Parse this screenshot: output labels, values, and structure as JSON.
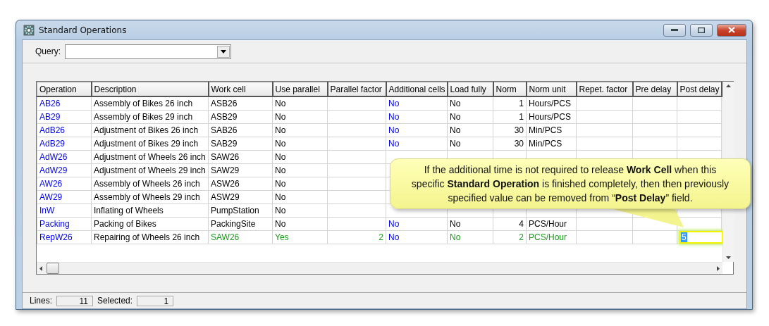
{
  "window": {
    "title": "Standard Operations"
  },
  "query": {
    "label": "Query:"
  },
  "table": {
    "columns": [
      "Operation",
      "Description",
      "Work cell",
      "Use parallel",
      "Parallel factor",
      "Additional cells",
      "Load fully",
      "Norm",
      "Norm unit",
      "Repet. factor",
      "Pre delay",
      "Post delay"
    ],
    "rows": [
      {
        "selected": false,
        "operation": "AB26",
        "description": "Assembly of Bikes 26 inch",
        "work_cell": "ASB26",
        "use_parallel": "No",
        "additional_cells": "No",
        "load_fully": "No",
        "norm": "1",
        "norm_unit": "Hours/PCS"
      },
      {
        "selected": false,
        "operation": "AB29",
        "description": "Assembly of Bikes 29 inch",
        "work_cell": "ASB29",
        "use_parallel": "No",
        "additional_cells": "No",
        "load_fully": "No",
        "norm": "1",
        "norm_unit": "Hours/PCS"
      },
      {
        "selected": false,
        "operation": "AdB26",
        "description": "Adjustment of Bikes 26 inch",
        "work_cell": "SAB26",
        "use_parallel": "No",
        "additional_cells": "No",
        "load_fully": "No",
        "norm": "30",
        "norm_unit": "Min/PCS"
      },
      {
        "selected": false,
        "operation": "AdB29",
        "description": "Adjustment of Bikes 29 inch",
        "work_cell": "SAB29",
        "use_parallel": "No",
        "additional_cells": "No",
        "load_fully": "No",
        "norm": "30",
        "norm_unit": "Min/PCS"
      },
      {
        "selected": false,
        "operation": "AdW26",
        "description": "Adjustment of Wheels 26 inch",
        "work_cell": "SAW26",
        "use_parallel": "No"
      },
      {
        "selected": false,
        "operation": "AdW29",
        "description": "Adjustment of Wheels 29 inch",
        "work_cell": "SAW29",
        "use_parallel": "No"
      },
      {
        "selected": false,
        "operation": "AW26",
        "description": "Assembly of Wheels 26 inch",
        "work_cell": "ASW26",
        "use_parallel": "No"
      },
      {
        "selected": false,
        "operation": "AW29",
        "description": "Assembly of Wheels 29 inch",
        "work_cell": "ASW29",
        "use_parallel": "No"
      },
      {
        "selected": false,
        "operation": "InW",
        "description": "Inflating of Wheels",
        "work_cell": "PumpStation",
        "use_parallel": "No"
      },
      {
        "selected": false,
        "operation": "Packing",
        "description": "Packing of Bikes",
        "work_cell": "PackingSite",
        "use_parallel": "No",
        "additional_cells": "No",
        "load_fully": "No",
        "norm": "4",
        "norm_unit": "PCS/Hour"
      },
      {
        "selected": true,
        "operation": "RepW26",
        "description": "Repairing of Wheels 26 inch",
        "work_cell": "SAW26",
        "use_parallel": "Yes",
        "parallel_factor": "2",
        "additional_cells": "No",
        "load_fully": "No",
        "norm": "2",
        "norm_unit": "PCS/Hour",
        "post_delay": "5"
      }
    ]
  },
  "callout": {
    "text": "If the additional time is not required to release **Work Cell** when this specific **Standard Operation** is finished completely, then then previously specified value can be removed from “**Post Delay**” field."
  },
  "status_bar": {
    "lines_label": "Lines:",
    "lines": "11",
    "selected_label": "Selected:",
    "selected": "1"
  }
}
